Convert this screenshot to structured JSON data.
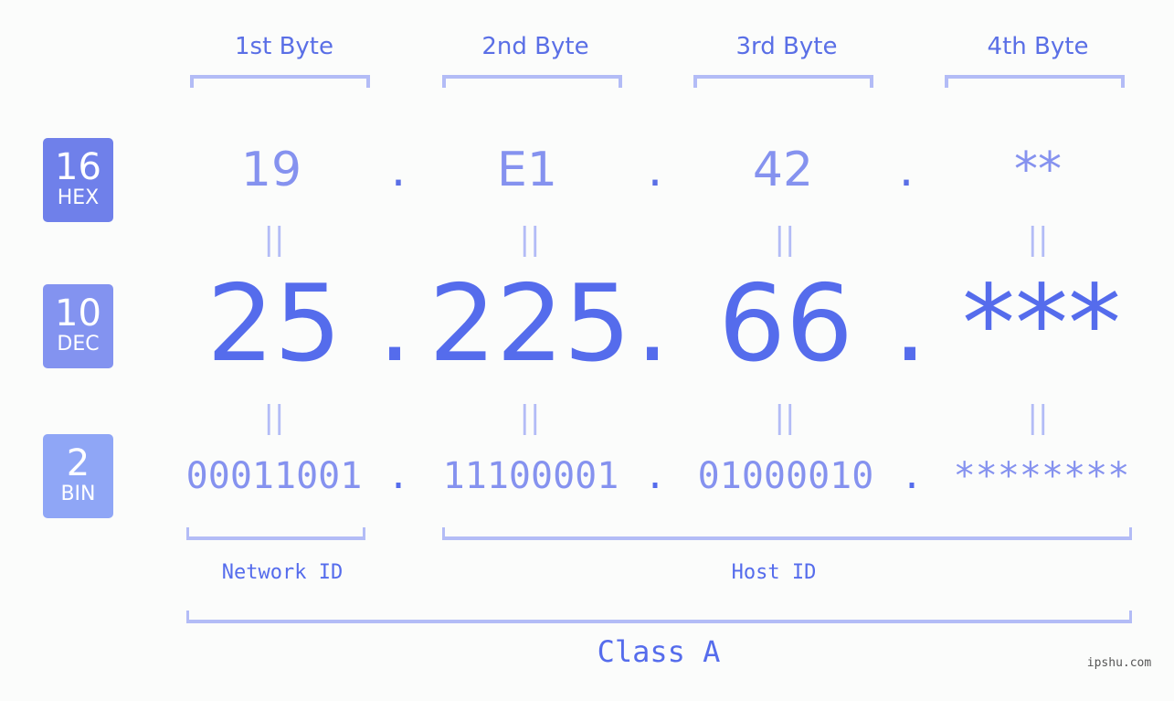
{
  "colors": {
    "hex_badge": "#6f80ea",
    "dec_badge": "#8393f0",
    "bin_badge": "#8fa6f6",
    "primary": "#556cec",
    "secondary": "#8592ef",
    "bracket": "#b3bcf6",
    "background": "#fbfcfb"
  },
  "badges": {
    "hex": {
      "number": "16",
      "label": "HEX"
    },
    "dec": {
      "number": "10",
      "label": "DEC"
    },
    "bin": {
      "number": "2",
      "label": "BIN"
    }
  },
  "byte_headers": [
    "1st Byte",
    "2nd Byte",
    "3rd Byte",
    "4th Byte"
  ],
  "separator": ".",
  "equals": "||",
  "hex_values": [
    "19",
    "E1",
    "42",
    "**"
  ],
  "dec_values": [
    "25",
    "225",
    "66",
    "***"
  ],
  "bin_values": [
    "00011001",
    "11100001",
    "01000010",
    "********"
  ],
  "labels": {
    "network_id": "Network ID",
    "host_id": "Host ID",
    "class": "Class A"
  },
  "watermark": "ipshu.com"
}
